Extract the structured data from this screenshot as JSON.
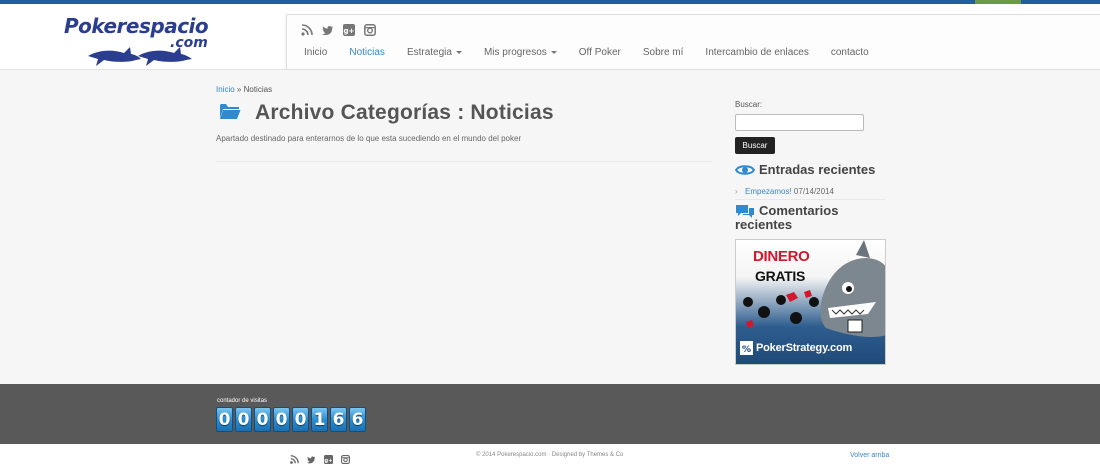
{
  "site": {
    "logo_text": "Pokerespacio",
    "logo_suffix": ".com"
  },
  "social_icons": [
    "rss-icon",
    "twitter-icon",
    "google-plus-icon",
    "instagram-icon"
  ],
  "nav": {
    "items": [
      {
        "label": "Inicio",
        "active": false,
        "dropdown": false
      },
      {
        "label": "Noticias",
        "active": true,
        "dropdown": false
      },
      {
        "label": "Estrategia",
        "active": false,
        "dropdown": true
      },
      {
        "label": "Mis progresos",
        "active": false,
        "dropdown": true
      },
      {
        "label": "Off Poker",
        "active": false,
        "dropdown": false
      },
      {
        "label": "Sobre mí",
        "active": false,
        "dropdown": false
      },
      {
        "label": "Intercambio de enlaces",
        "active": false,
        "dropdown": false
      },
      {
        "label": "contacto",
        "active": false,
        "dropdown": false
      }
    ]
  },
  "breadcrumb": {
    "home": "Inicio",
    "separator": "»",
    "current": "Noticias"
  },
  "page": {
    "title": "Archivo Categorías : Noticias",
    "description": "Apartado destinado para enterarnos de lo que esta sucediendo en el mundo del poker"
  },
  "sidebar": {
    "search_label": "Buscar:",
    "search_value": "",
    "search_button": "Buscar",
    "recent_title": "Entradas recientes",
    "recent_posts": [
      {
        "title": "Empezamos!",
        "date": "07/14/2014"
      }
    ],
    "comments_title_line1": "Comentarios",
    "comments_title_line2": "recientes",
    "banner": {
      "line1": "DINERO",
      "line2": "GRATIS",
      "brand": "PokerStrategy.com"
    }
  },
  "footer": {
    "counter_label": "contador de visitas",
    "counter_digits": [
      "0",
      "0",
      "0",
      "0",
      "0",
      "1",
      "6",
      "6"
    ],
    "copyright": "© 2014 Pokerespacio.com · Designed by Themes & Co",
    "back_to_top": "Volver arriba"
  },
  "colors": {
    "accent": "#3a87c8",
    "top_stripe": "#1f5f9e",
    "footer_dark": "#595959"
  }
}
